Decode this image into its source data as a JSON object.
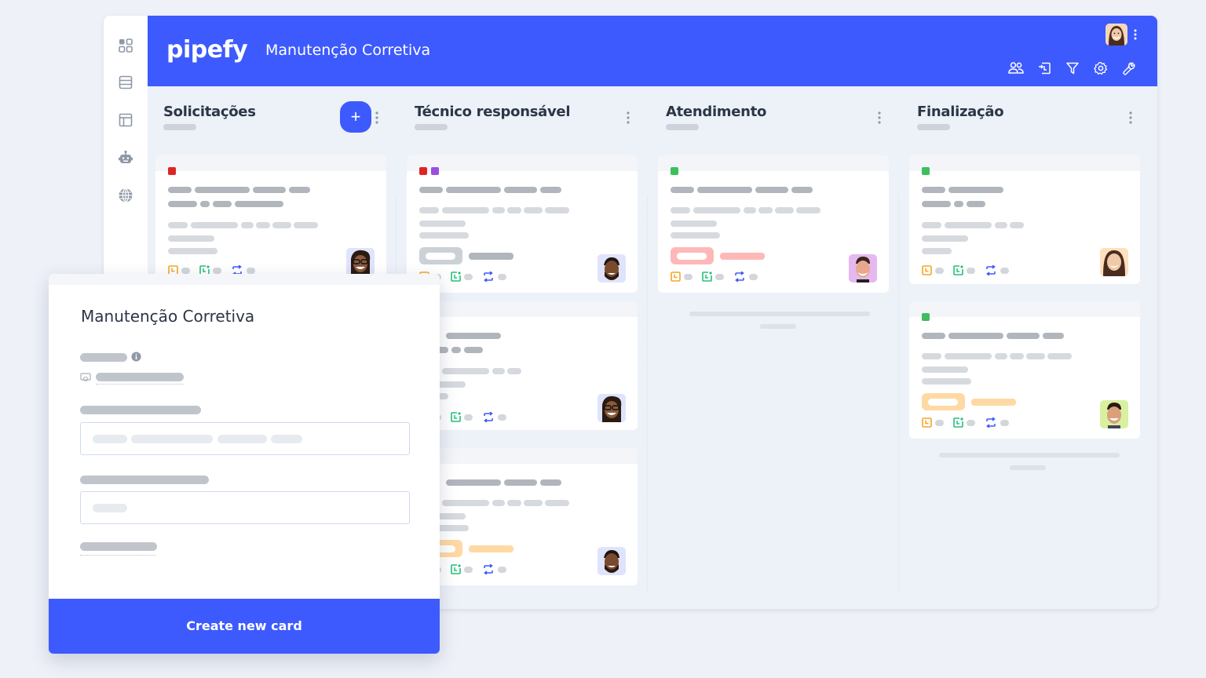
{
  "app": {
    "logo": "pipefy",
    "pipe_title": "Manutenção Corretiva",
    "accent": "#3d5afe"
  },
  "sidebar": {
    "items": [
      {
        "icon": "dashboard-grid-icon"
      },
      {
        "icon": "database-table-icon"
      },
      {
        "icon": "layout-panel-icon"
      },
      {
        "icon": "robot-automation-icon"
      },
      {
        "icon": "globe-icon"
      }
    ]
  },
  "topbar": {
    "tools": [
      {
        "icon": "members-icon"
      },
      {
        "icon": "import-icon"
      },
      {
        "icon": "filter-icon"
      },
      {
        "icon": "settings-gear-icon"
      },
      {
        "icon": "wrench-icon"
      }
    ]
  },
  "phases": [
    {
      "title": "Solicitações",
      "has_add_button": true,
      "add_label": "+"
    },
    {
      "title": "Técnico responsável"
    },
    {
      "title": "Atendimento"
    },
    {
      "title": "Finalização"
    }
  ],
  "card_label_colors": {
    "red": "#e02424",
    "purple": "#9b4fe0",
    "green": "#3dbf5a"
  },
  "modal": {
    "title": "Manutenção Corretiva",
    "button_label": "Create new card"
  }
}
